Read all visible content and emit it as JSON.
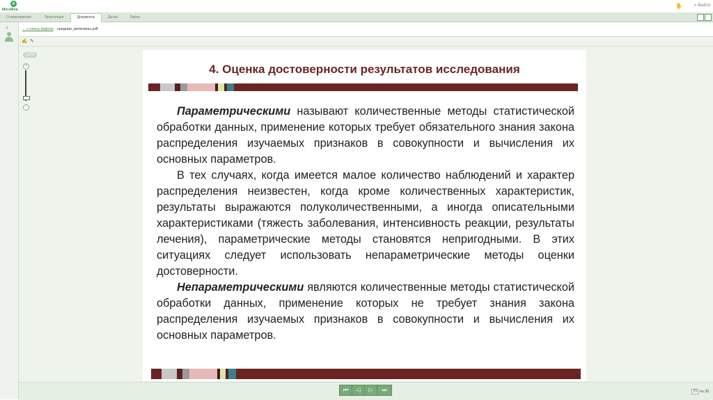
{
  "brand": {
    "logo_mark": "e",
    "logo_text": "МегаФон"
  },
  "header": {
    "exit_label": "Выйти"
  },
  "tabs": [
    {
      "label": "О мероприятии"
    },
    {
      "label": "Трансляция"
    },
    {
      "label": "Документы"
    },
    {
      "label": "Доска"
    },
    {
      "label": "Опрос"
    }
  ],
  "breadcrumb": {
    "back_label": "к списку файлов",
    "file_name": "средние_величины.pdf"
  },
  "zoom": {
    "label": "100%",
    "plus": "+",
    "minus": "−"
  },
  "slide": {
    "title": "4. Оценка достоверности результатов исследования",
    "p1_bold": "Параметрическими",
    "p1_rest": " называют количественные методы статистической обработки данных, применение которых требует обязательного знания закона распределения изучаемых признаков в совокупности и вычисления их основных параметров.",
    "p2": "В тех случаях, когда имеется малое количество наблюдений и характер распределения неизвестен, когда кроме количественных характеристик, результаты выражаются полуколичественными, а иногда описательными характеристиками (тяжесть заболевания, интенсивность реакции, результаты лечения), параметрические методы становятся непригодными. В этих ситуациях следует использовать непараметрические методы оценки достоверности.",
    "p3_bold": "Непараметрическими",
    "p3_rest": " являются количественные методы статистической обработки данных, применение которых не требует знания закона распределения изучаемых признаков в совокупности и вычисления их основных параметров."
  },
  "pager": {
    "current": "23",
    "total_label": "из 35"
  },
  "colors": {
    "accent_green": "#7aa97a",
    "title_maroon": "#6b2424",
    "stripe_main": "#6b2424"
  }
}
